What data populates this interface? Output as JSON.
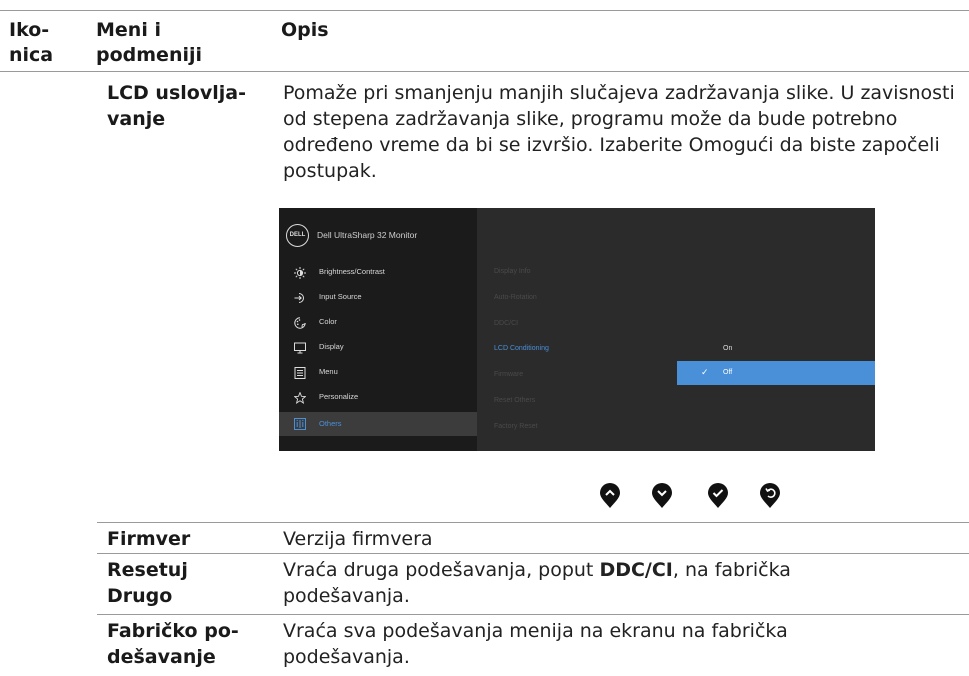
{
  "header": {
    "col1": "Iko-\nnica",
    "col2": "Meni i\npodmeniji",
    "col3": "Opis"
  },
  "rows": [
    {
      "label": "LCD uslovlja-\nvanje",
      "desc": "Pomaže pri smanjenju manjih slučajeva zadržavanja slike. U zavisnosti od stepena zadržavanja slike, programu može da bude potrebno određeno vreme da bi se izvršio. Izaberite Omogući da biste započeli postupak."
    },
    {
      "label": "Firmver",
      "desc": "Verzija firmvera"
    },
    {
      "label": "Resetuj\nDrugo",
      "desc_pre": "Vraća druga podešavanja, poput ",
      "desc_bold": "DDC/CI",
      "desc_post": ", na fabrička\npodešavanja."
    },
    {
      "label": "Fabričko po-\ndešavanje",
      "desc": "Vraća sva podešavanja menija na ekranu na fabrička\npodešavanja."
    }
  ],
  "osd": {
    "logo": "DELL",
    "title": "Dell UltraSharp 32 Monitor",
    "menu": [
      {
        "label": "Brightness/Contrast",
        "icon": "brightness-icon"
      },
      {
        "label": "Input Source",
        "icon": "input-source-icon"
      },
      {
        "label": "Color",
        "icon": "color-icon"
      },
      {
        "label": "Display",
        "icon": "display-icon"
      },
      {
        "label": "Menu",
        "icon": "menu-icon"
      },
      {
        "label": "Personalize",
        "icon": "star-icon"
      },
      {
        "label": "Others",
        "icon": "others-icon",
        "selected": true
      }
    ],
    "submenu": [
      "Display Info",
      "Auto-Rotation",
      "DDC/CI",
      "LCD Conditioning",
      "Firmware",
      "Reset Others",
      "Factory Reset"
    ],
    "submenu_active": "LCD Conditioning",
    "options": [
      "On",
      "Off"
    ],
    "selected_option": "Off",
    "colors": {
      "bg": "#2b2b2b",
      "left_panel": "#1b1b1b",
      "accent": "#4a90d9"
    }
  },
  "nav_buttons": [
    "up-button-icon",
    "down-button-icon",
    "confirm-button-icon",
    "back-button-icon"
  ]
}
